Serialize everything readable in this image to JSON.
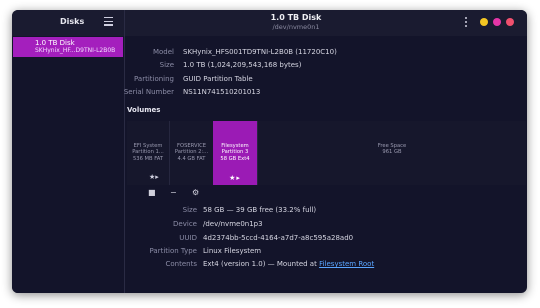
{
  "sidebar": {
    "header": "Disks",
    "items": [
      {
        "title": "1.0 TB Disk",
        "subtitle": "SKHynix_HF...D9TNI-L2B0B"
      }
    ]
  },
  "header": {
    "title": "1.0 TB Disk",
    "subtitle": "/dev/nvme0n1"
  },
  "window_buttons": {
    "minimize": "#f3c623",
    "maximize": "#e535a8",
    "close": "#f0506e"
  },
  "disk": {
    "model_label": "Model",
    "model": "SKHynix_HFS001TD9TNI-L2B0B (11720C10)",
    "size_label": "Size",
    "size": "1.0 TB (1,024,209,543,168 bytes)",
    "partitioning_label": "Partitioning",
    "partitioning": "GUID Partition Table",
    "serial_label": "Serial Number",
    "serial": "NS11N741510201013"
  },
  "volumes": {
    "title": "Volumes",
    "partitions": [
      {
        "line1": "EFI System",
        "line2": "Partition 1...",
        "line3": "536 MB FAT"
      },
      {
        "line1": "FOSERVICE",
        "line2": "Partition 2:...",
        "line3": "4.4 GB FAT"
      },
      {
        "line1": "Filesystem",
        "line2": "Partition 3",
        "line3": "58 GB Ext4"
      },
      {
        "line1": "Free Space",
        "line2": "961 GB",
        "line3": ""
      }
    ]
  },
  "toolbar": {
    "stop": "■",
    "remove": "−",
    "settings": "⚙"
  },
  "selected": {
    "size_label": "Size",
    "size": "58 GB — 39 GB free (33.2% full)",
    "device_label": "Device",
    "device": "/dev/nvme0n1p3",
    "uuid_label": "UUID",
    "uuid": "4d2374bb-5ccd-4164-a7d7-a8c595a28ad0",
    "type_label": "Partition Type",
    "type": "Linux Filesystem",
    "contents_label": "Contents",
    "contents_prefix": "Ext4 (version 1.0) — Mounted at ",
    "contents_link": "Filesystem Root"
  }
}
